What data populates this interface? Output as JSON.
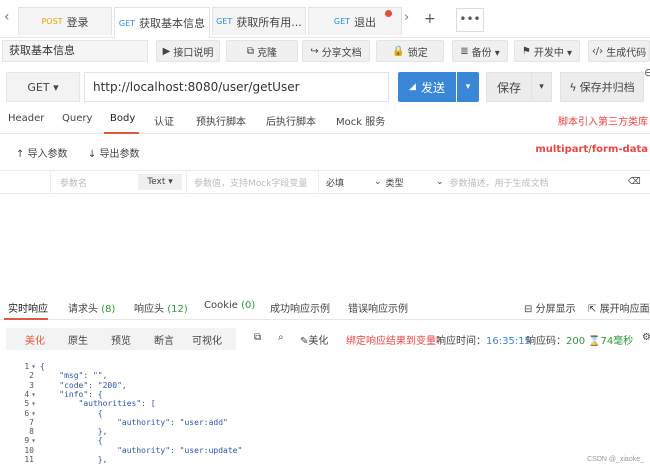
{
  "tabbar": {
    "tabs": [
      {
        "method": "POST",
        "label": "登录",
        "active": false
      },
      {
        "method": "GET",
        "label": "获取基本信息",
        "active": true
      },
      {
        "method": "GET",
        "label": "获取所有用...",
        "active": false
      },
      {
        "method": "GET",
        "label": "退出",
        "active": false,
        "dot": true
      }
    ],
    "plus": "+",
    "more": "•••",
    "nav_left": "‹",
    "nav_right": "›"
  },
  "toolbar": {
    "name_value": "获取基本信息",
    "buttons": [
      {
        "icon": "▶",
        "label": "接口说明"
      },
      {
        "icon": "⧉",
        "label": "克隆"
      },
      {
        "icon": "↪",
        "label": "分享文档"
      },
      {
        "icon": "🔒",
        "label": "锁定"
      },
      {
        "icon": "≣",
        "label": "备份 ▾"
      },
      {
        "icon": "⚑",
        "label": "开发中 ▾"
      },
      {
        "icon": "‹/›",
        "label": "生成代码"
      }
    ]
  },
  "request": {
    "method": "GET ▾",
    "url": "http://localhost:8080/user/getUser",
    "send_label": "发送",
    "send_icon": "◢",
    "send_drop": "▾",
    "save_label": "保存",
    "save_drop": "▾",
    "save_archive_label": "保存并归档",
    "save_archive_icon": "ϟ",
    "corner_icon": "⊖"
  },
  "req_tabs": {
    "items": [
      "Header",
      "Query",
      "Body",
      "认证",
      "预执行脚本",
      "后执行脚本",
      "Mock 服务"
    ],
    "active": "Body",
    "right_text": "脚本引入第三方类库"
  },
  "body": {
    "import_label": "↑ 导入参数",
    "export_label": "↓ 导出参数",
    "form_type": "multipart/form-data"
  },
  "param_row": {
    "name_placeholder": "参数名",
    "type_value": "Text ▾",
    "value_placeholder": "参数值，支持Mock字段变量",
    "required": "必填",
    "type_label": "类型",
    "desc_placeholder": "参数描述，用于生成文档",
    "delete_icon": "⌫"
  },
  "resp_tabs": {
    "items": [
      {
        "label": "实时响应",
        "count": ""
      },
      {
        "label": "请求头",
        "count": "(8)"
      },
      {
        "label": "响应头",
        "count": "(12)"
      },
      {
        "label": "Cookie",
        "count": "(0)"
      },
      {
        "label": "成功响应示例",
        "count": ""
      },
      {
        "label": "错误响应示例",
        "count": ""
      }
    ],
    "split_label": "分屏显示",
    "expand_label": "展开响应面板"
  },
  "resp_toolbar": {
    "formats": [
      "美化",
      "原生",
      "预览",
      "断言",
      "可视化"
    ],
    "active_format": "美化",
    "beautify": "美化",
    "bind_text": "绑定响应结果到变量?",
    "time_label": "响应时间：",
    "time_value": "16:35:15",
    "code_label": "响应码：",
    "code_value": "200",
    "duration": "74毫秒"
  },
  "code_lines": [
    {
      "n": "1",
      "fold": true,
      "text": "{"
    },
    {
      "n": "2",
      "fold": false,
      "text": "    \"msg\": \"\","
    },
    {
      "n": "3",
      "fold": false,
      "text": "    \"code\": \"200\","
    },
    {
      "n": "4",
      "fold": true,
      "text": "    \"info\": {"
    },
    {
      "n": "5",
      "fold": true,
      "text": "        \"authorities\": ["
    },
    {
      "n": "6",
      "fold": true,
      "text": "            {"
    },
    {
      "n": "7",
      "fold": false,
      "text": "                \"authority\": \"user:add\""
    },
    {
      "n": "8",
      "fold": false,
      "text": "            },"
    },
    {
      "n": "9",
      "fold": true,
      "text": "            {"
    },
    {
      "n": "10",
      "fold": false,
      "text": "                \"authority\": \"user:update\""
    },
    {
      "n": "11",
      "fold": false,
      "text": "            },"
    }
  ],
  "watermark": "CSDN @_xiaoke_"
}
